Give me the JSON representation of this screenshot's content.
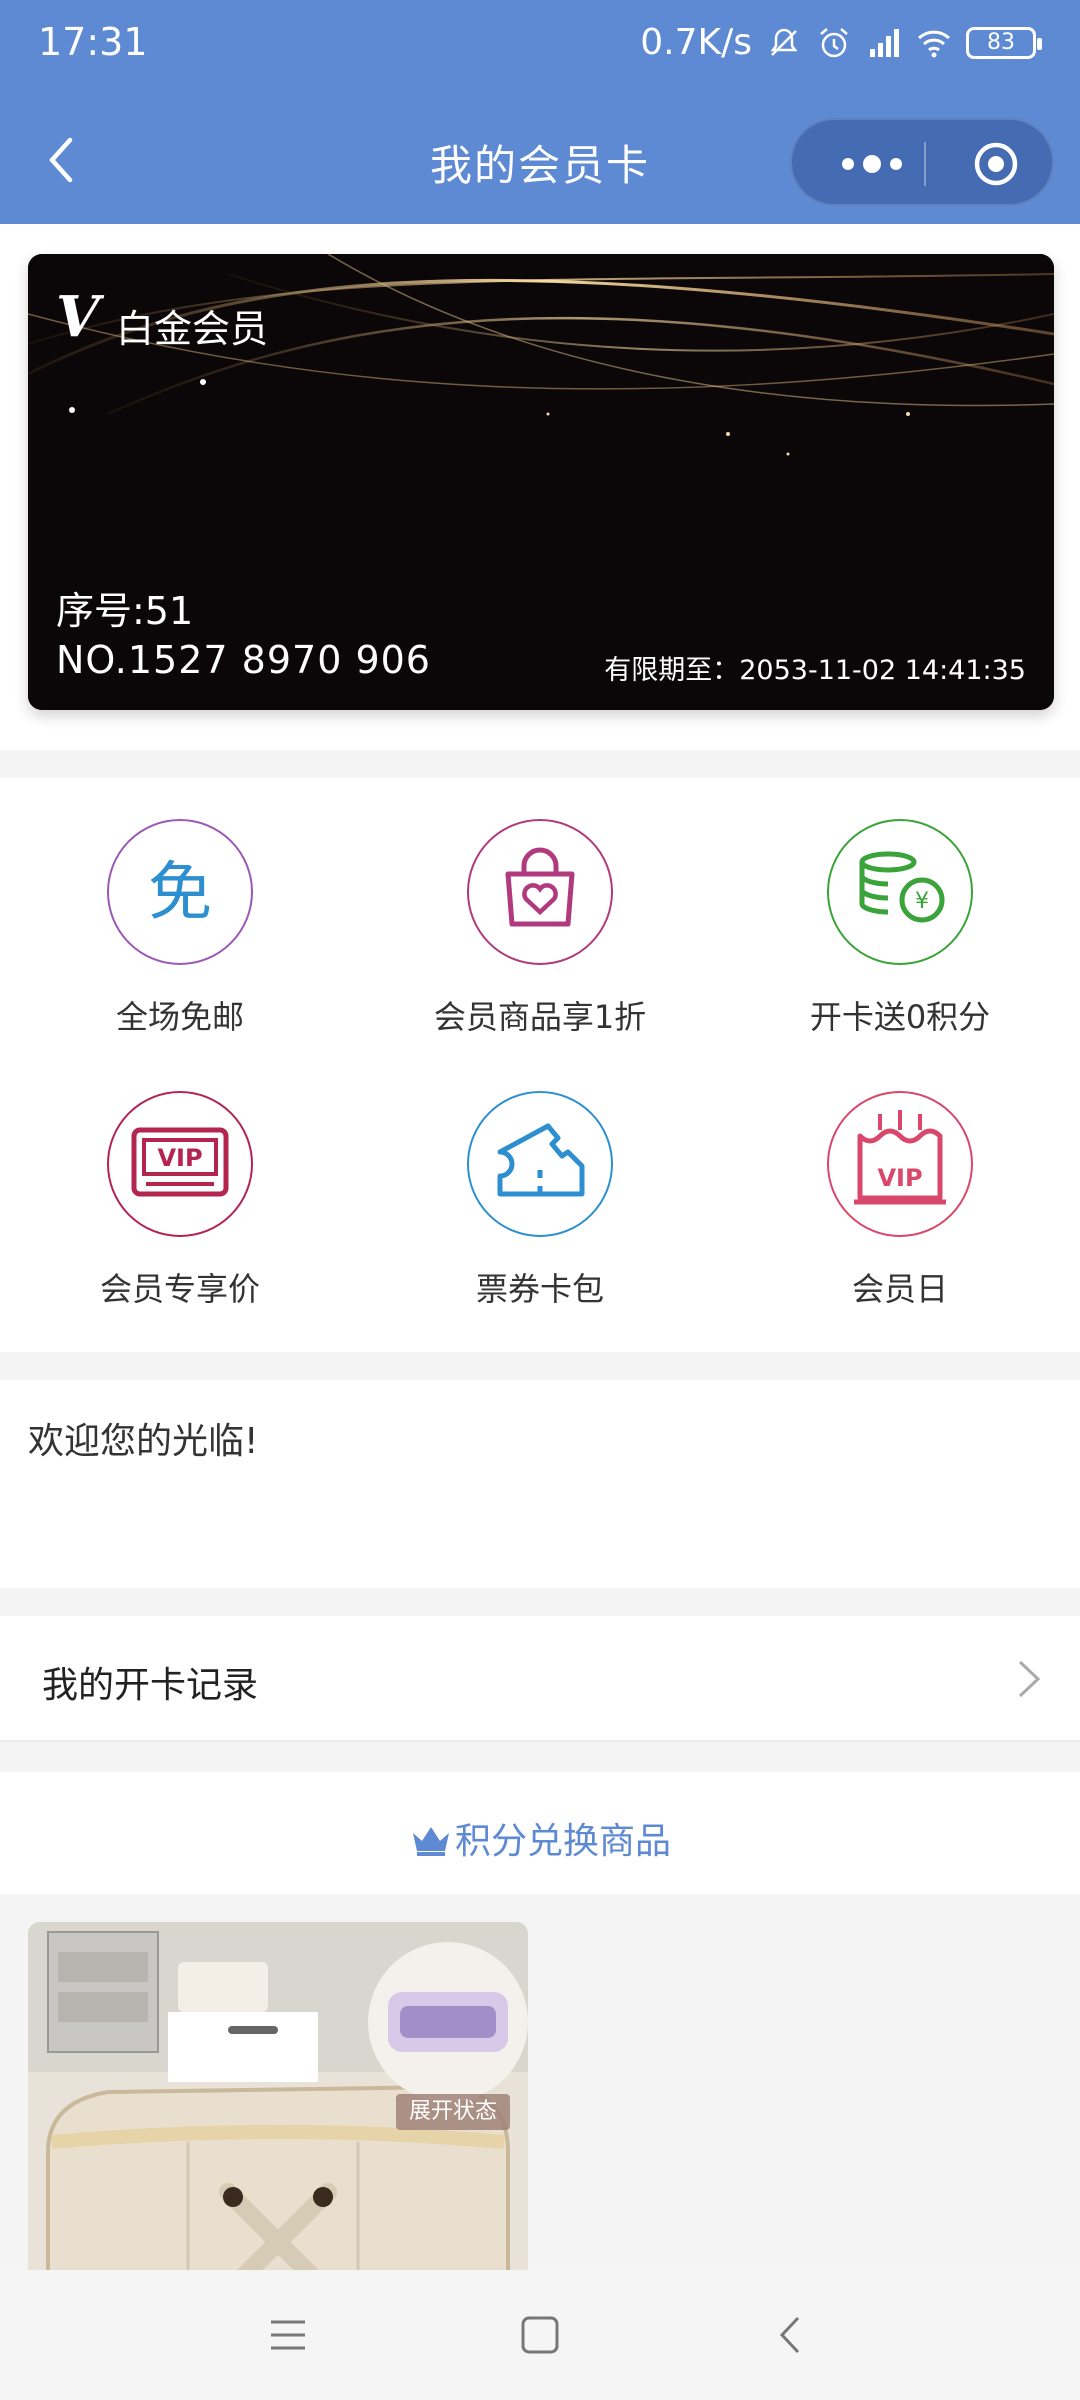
{
  "status_bar": {
    "time": "17:31",
    "network_speed": "0.7K/s",
    "battery": "83",
    "icons": [
      "mute-icon",
      "alarm-icon",
      "signal-icon",
      "wifi-icon",
      "battery-icon"
    ]
  },
  "nav": {
    "title": "我的会员卡",
    "back_icon": "back-icon",
    "more_icon": "more-icon",
    "close_icon": "target-icon"
  },
  "card": {
    "logo": "V",
    "level": "白金会员",
    "seq": "序号:51",
    "number": "NO.1527 8970 906",
    "expiry": "有限期至：2053-11-02 14:41:35"
  },
  "benefits": [
    {
      "label": "全场免邮",
      "icon": "free-shipping-icon",
      "color": "#9b59b6",
      "text": "免"
    },
    {
      "label": "会员商品享1折",
      "icon": "shopping-bag-heart-icon",
      "color": "#b03a7d"
    },
    {
      "label": "开卡送0积分",
      "icon": "coins-icon",
      "color": "#3aa33a",
      "text": "¥"
    },
    {
      "label": "会员专享价",
      "icon": "vip-ticket-icon",
      "color": "#b3244f",
      "text": "VIP"
    },
    {
      "label": "票券卡包",
      "icon": "ticket-icon",
      "color": "#2d8fd0"
    },
    {
      "label": "会员日",
      "icon": "birthday-cake-icon",
      "color": "#d9476a",
      "text": "VIP"
    }
  ],
  "welcome": {
    "text": "欢迎您的光临!"
  },
  "records": {
    "label": "我的开卡记录"
  },
  "points": {
    "title": "积分兑换商品"
  },
  "product": {
    "tag": "展开状态"
  },
  "colors": {
    "header": "#5e89d3",
    "accent": "#5e89d3"
  }
}
